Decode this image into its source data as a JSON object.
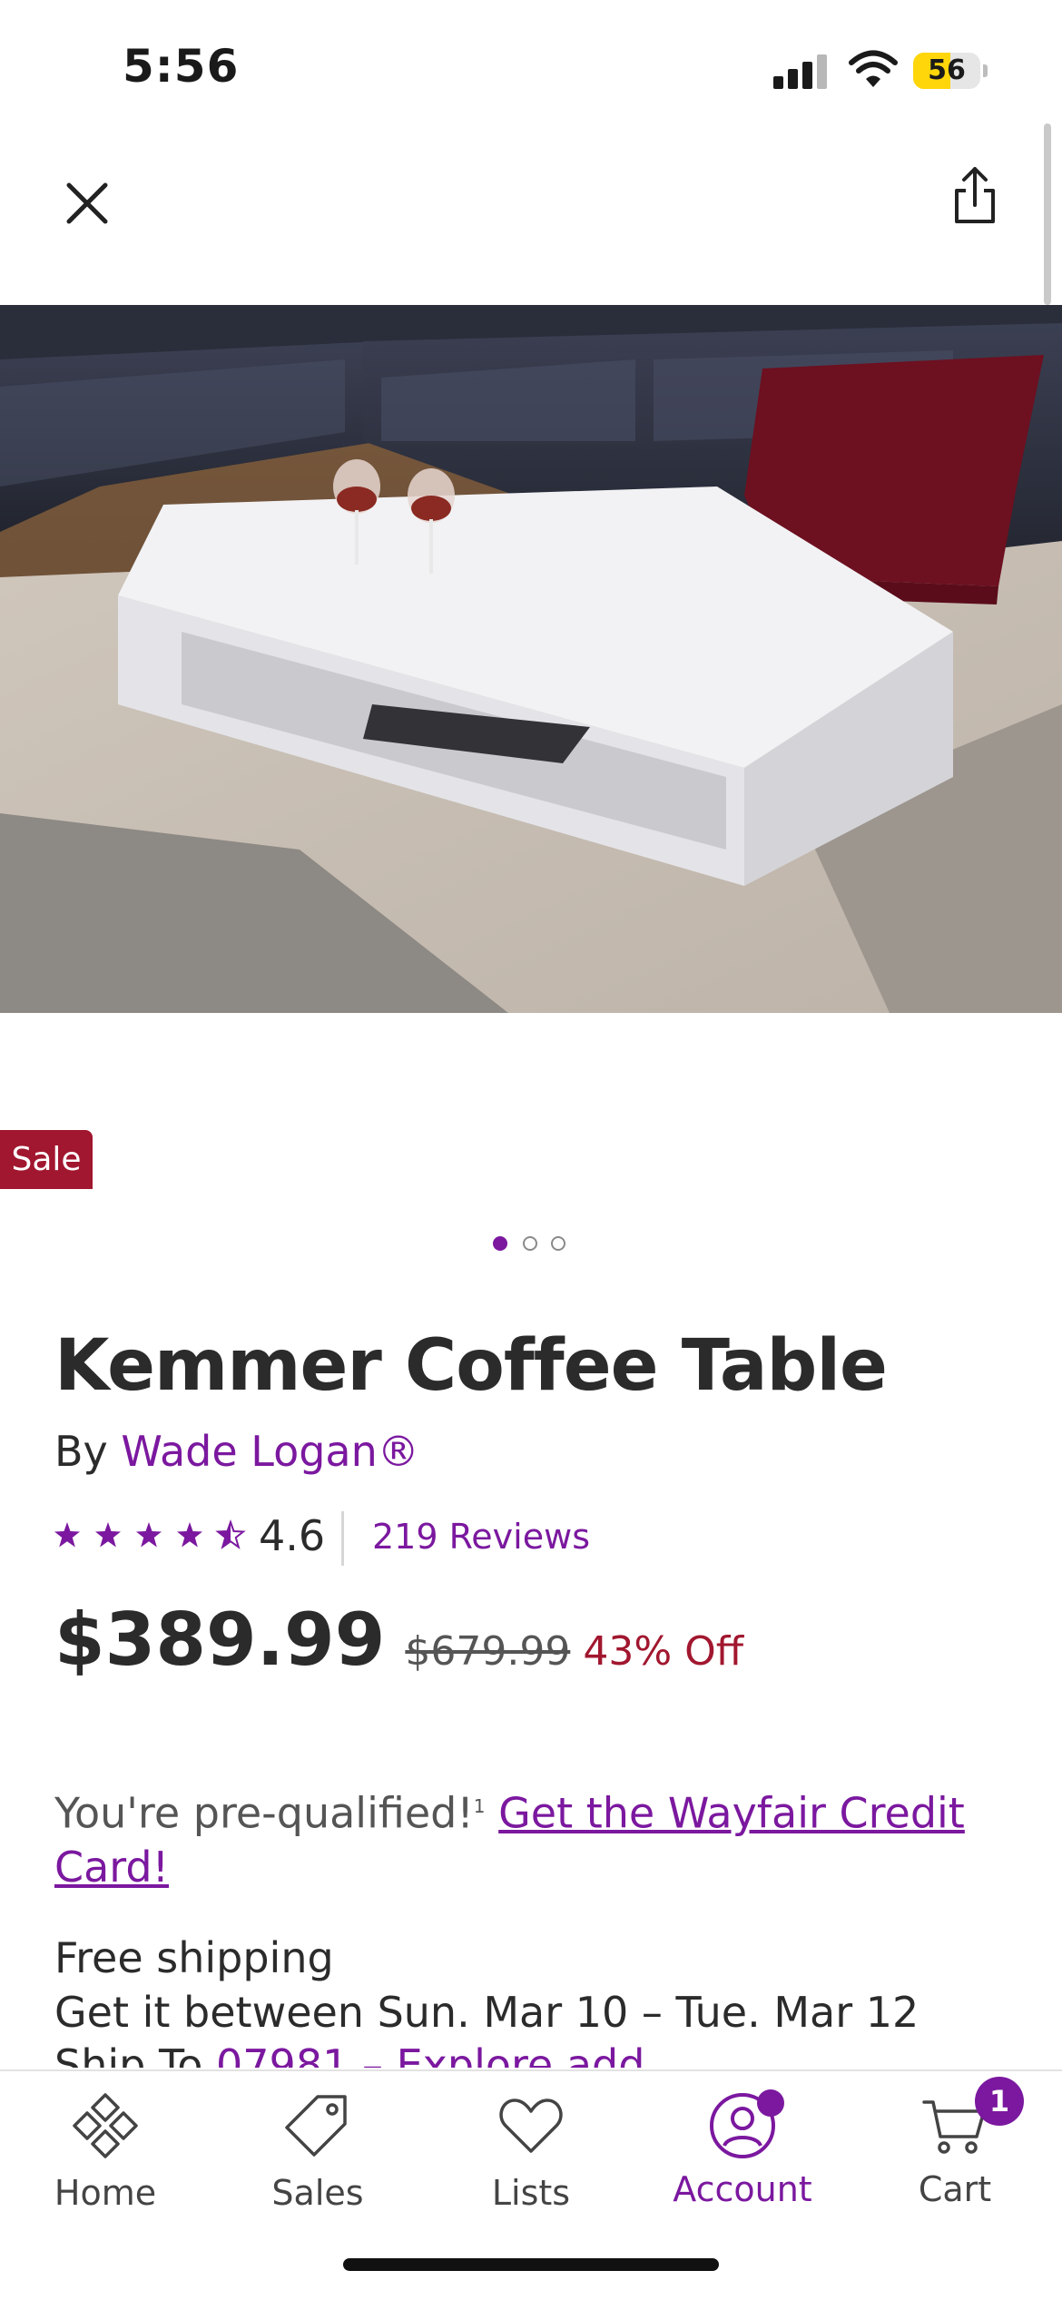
{
  "status_bar": {
    "time": "5:56",
    "battery": "56",
    "battery_level": 0.56
  },
  "top_bar": {
    "close_icon": "close-icon",
    "share_icon": "share-icon"
  },
  "image": {
    "sale_badge": "Sale",
    "carousel_count": 3,
    "carousel_active": 1
  },
  "product": {
    "title": "Kemmer Coffee Table",
    "by_label": "By",
    "brand": "Wade Logan®",
    "rating": "4.6",
    "rating_stars": 4.5,
    "reviews": "219 Reviews",
    "price": "$389.99",
    "original_price": "$679.99",
    "discount": "43% Off"
  },
  "credit": {
    "prequalified": "You're pre-qualified!",
    "footnote": "1",
    "link": "Get the Wayfair Credit Card!"
  },
  "shipping": {
    "title": "Free shipping",
    "dates": "Get it between Sun. Mar 10 – Tue. Mar 12",
    "ship_to_label": "Ship To",
    "zip": "07981 – Explore add"
  },
  "bottom_nav": [
    {
      "label": "Home",
      "icon": "home-icon"
    },
    {
      "label": "Sales",
      "icon": "tag-icon"
    },
    {
      "label": "Lists",
      "icon": "heart-icon"
    },
    {
      "label": "Account",
      "icon": "account-icon"
    },
    {
      "label": "Cart",
      "icon": "cart-icon",
      "badge": "1"
    }
  ],
  "colors": {
    "brand_purple": "#7b189f",
    "sale_red": "#a1172f",
    "battery_yellow": "#ffd60a"
  }
}
